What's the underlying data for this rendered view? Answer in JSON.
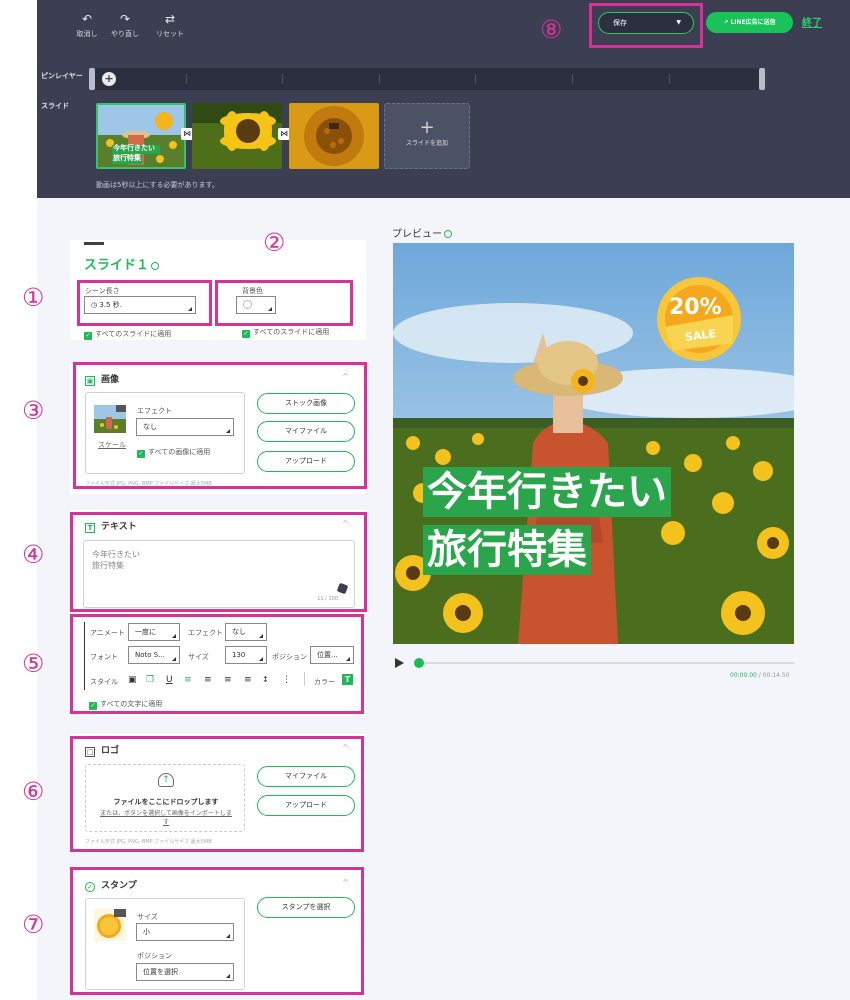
{
  "toolbar": {
    "undo": "取消し",
    "redo": "やり直し",
    "reset": "リセット",
    "save": "保存",
    "send_line": "LINE広告に送信",
    "end": "終了"
  },
  "timeline": {
    "layer_label": "ピンレイヤー",
    "slide_label": "スライド",
    "add_slide": "スライドを追加",
    "note": "動画は5秒以上にする必要があります。",
    "thumb1_text_line1": "今年行きたい",
    "thumb1_text_line2": "旅行特集"
  },
  "slide_panel": {
    "title": "スライド１",
    "scene_length_label": "シーン長さ",
    "scene_length_value": "3.5 秒.",
    "bg_color_label": "背景色",
    "apply_all_slides_1": "すべてのスライドに適用",
    "apply_all_slides_2": "すべてのスライドに適用"
  },
  "image_section": {
    "title": "画像",
    "effect_label": "エフェクト",
    "effect_value": "なし",
    "scale_link": "スケール",
    "apply_all_images": "すべての画像に適用",
    "stock_btn": "ストック画像",
    "myfile_btn": "マイファイル",
    "upload_btn": "アップロード",
    "note": "ファイル形式 JPG, PNG, BMP ファイルサイズ 最大5MB"
  },
  "text_section": {
    "title": "テキスト",
    "line1": "今年行きたい",
    "line2": "旅行特集",
    "count": "11 / 100"
  },
  "text_options": {
    "animate_label": "アニメート",
    "animate_value": "一度に",
    "effect_label": "エフェクト",
    "effect_value": "なし",
    "font_label": "フォント",
    "font_value": "Noto S...",
    "size_label": "サイズ",
    "size_value": "130",
    "position_label": "ポジション",
    "position_value": "位置...",
    "style_label": "スタイル",
    "color_label": "カラー",
    "apply_all_text": "すべての文字に適用"
  },
  "logo_section": {
    "title": "ロゴ",
    "drop_text": "ファイルをここにドロップします",
    "select_text_1": "または、ボタンを選択して画像をインポートしま",
    "select_text_2": "す",
    "myfile_btn": "マイファイル",
    "upload_btn": "アップロード",
    "note": "ファイル形式 JPG, PNG, BMP ファイルサイズ 最大5MB"
  },
  "stamp_section": {
    "title": "スタンプ",
    "select_btn": "スタンプを選択",
    "size_label": "サイズ",
    "size_value": "小",
    "position_label": "ポジション",
    "position_value": "位置を選択"
  },
  "preview": {
    "label": "プレビュー",
    "headline_line1": "今年行きたい",
    "headline_line2": "旅行特集",
    "badge_percent": "20%",
    "badge_sale": "SALE",
    "time_current": "00:00.00",
    "time_total": " / 00:14.50"
  },
  "annotations": [
    "①",
    "②",
    "③",
    "④",
    "⑤",
    "⑥",
    "⑦",
    "⑧"
  ],
  "colors": {
    "brand_green": "#20b957",
    "highlight_pink": "#d6329a",
    "dark_panel": "#3c3f52"
  }
}
